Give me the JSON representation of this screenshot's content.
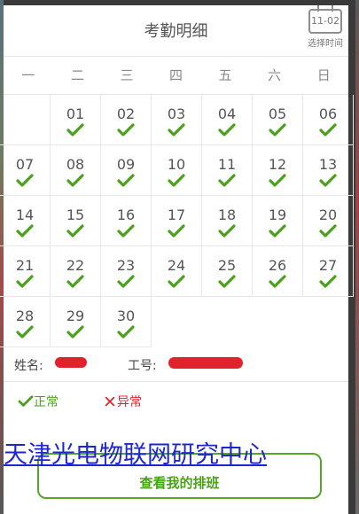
{
  "header": {
    "title": "考勤明细",
    "picker_date": "11-02",
    "picker_label": "选择时间"
  },
  "weekdays": [
    "一",
    "二",
    "三",
    "四",
    "五",
    "六",
    "日"
  ],
  "calendar": {
    "leading_blanks": 1,
    "days": [
      "01",
      "02",
      "03",
      "04",
      "05",
      "06",
      "07",
      "08",
      "09",
      "10",
      "11",
      "12",
      "13",
      "14",
      "15",
      "16",
      "17",
      "18",
      "19",
      "20",
      "21",
      "22",
      "23",
      "24",
      "25",
      "26",
      "27",
      "28",
      "29",
      "30"
    ],
    "status_all": "normal"
  },
  "info": {
    "name_label": "姓名:",
    "id_label": "工号:"
  },
  "legend": {
    "normal": "正常",
    "abnormal": "异常",
    "normal_color": "#4aa21b",
    "abnormal_color": "#e0222a"
  },
  "banner": {
    "text": "天津光电物联网研究中心",
    "color": "#1d27d0"
  },
  "button": {
    "label": "查看我的排班"
  }
}
